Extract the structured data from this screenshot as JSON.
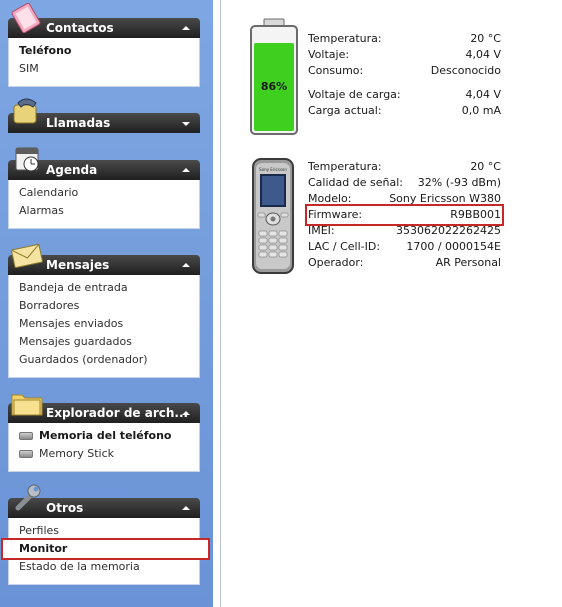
{
  "sidebar": {
    "sections": {
      "contactos": {
        "title": "Contactos",
        "items": [
          "Teléfono",
          "SIM"
        ]
      },
      "llamadas": {
        "title": "Llamadas"
      },
      "agenda": {
        "title": "Agenda",
        "items": [
          "Calendario",
          "Alarmas"
        ]
      },
      "mensajes": {
        "title": "Mensajes",
        "items": [
          "Bandeja de entrada",
          "Borradores",
          "Mensajes enviados",
          "Mensajes guardados",
          "Guardados (ordenador)"
        ]
      },
      "explorador": {
        "title": "Explorador de arch...",
        "items": [
          "Memoria del teléfono",
          "Memory Stick"
        ]
      },
      "otros": {
        "title": "Otros",
        "items": [
          "Perfiles",
          "Monitor",
          "Estado de la memoria"
        ]
      }
    }
  },
  "battery": {
    "percent_label": "86%",
    "level": 0.86,
    "rows": [
      {
        "label": "Temperatura:",
        "value": "20 °C"
      },
      {
        "label": "Voltaje:",
        "value": "4,04 V"
      },
      {
        "label": "Consumo:",
        "value": "Desconocido"
      },
      {
        "label": "Voltaje de carga:",
        "value": "4,04 V"
      },
      {
        "label": "Carga actual:",
        "value": "0,0 mA"
      }
    ]
  },
  "phone": {
    "brand_label": "Sony Ericsson",
    "rows": [
      {
        "label": "Temperatura:",
        "value": "20 °C"
      },
      {
        "label": "Calidad de señal:",
        "value": "32% (-93 dBm)"
      },
      {
        "label": "Modelo:",
        "value": "Sony Ericsson W380"
      },
      {
        "label": "Firmware:",
        "value": "R9BB001"
      },
      {
        "label": "IMEI:",
        "value": "353062022262425"
      },
      {
        "label": "LAC / Cell-ID:",
        "value": "1700 / 0000154E"
      },
      {
        "label": "Operador:",
        "value": "AR Personal"
      }
    ]
  },
  "colors": {
    "sidebar_bg": "#7ea6e2",
    "header_bg": "#2a2a2a",
    "battery_green": "#3fd01f",
    "highlight_red": "#c62828"
  },
  "icons": {
    "contactos": "address-book-icon",
    "llamadas": "phone-handset-icon",
    "agenda": "calendar-icon",
    "mensajes": "envelope-icon",
    "explorador": "folder-icon",
    "otros": "wrench-icon",
    "drives": "drive-icon"
  }
}
